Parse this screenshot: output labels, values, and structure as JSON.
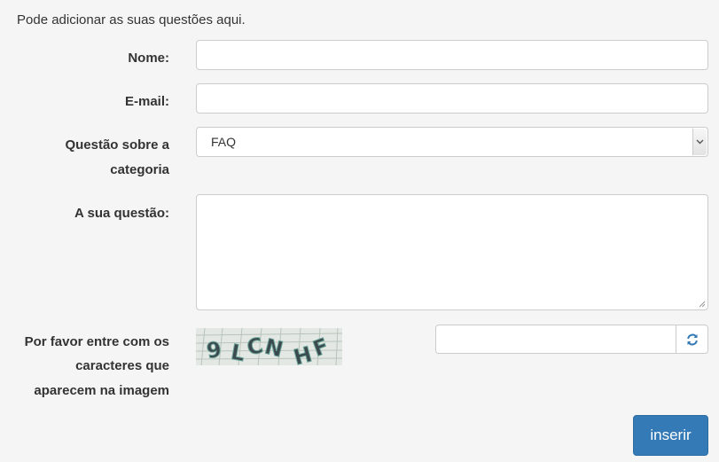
{
  "intro_text": "Pode adicionar as suas questões aqui.",
  "form": {
    "name_label": "Nome:",
    "name_value": "",
    "email_label": "E-mail:",
    "email_value": "",
    "category_label_line1": "Questão sobre a",
    "category_label_line2": "categoria",
    "category_selected": "FAQ",
    "question_label": "A sua questão:",
    "question_value": "",
    "captcha_label_line1": "Por favor entre com os",
    "captcha_label_line2": "caracteres que",
    "captcha_label_line3": "aparecem na imagem",
    "captcha_image_text": "9LCNHF",
    "captcha_value": "",
    "submit_label": "inserir"
  },
  "icons": {
    "refresh": "refresh-icon",
    "select_arrow": "chevron-down-icon",
    "resize": "resize-grip-icon"
  },
  "colors": {
    "background": "#f5f5f5",
    "primary": "#337ab7",
    "border": "#cccccc",
    "text": "#333333"
  }
}
